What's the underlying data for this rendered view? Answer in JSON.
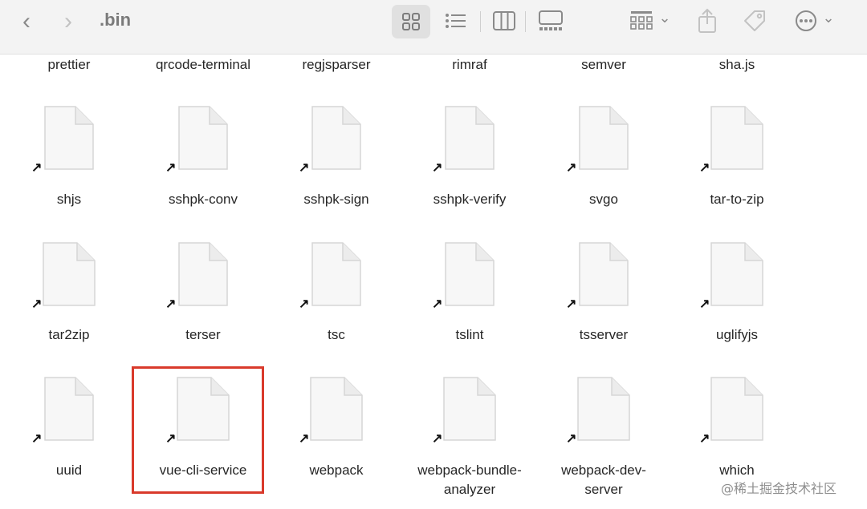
{
  "window": {
    "title": ".bin"
  },
  "toolbar": {
    "back": "‹",
    "forward": "›",
    "group_chevron": "⌄",
    "more_chevron": "⌄"
  },
  "files": {
    "row0": [
      "prettier",
      "qrcode-terminal",
      "regjsparser",
      "rimraf",
      "semver",
      "sha.js"
    ],
    "row1": [
      "shjs",
      "sshpk-conv",
      "sshpk-sign",
      "sshpk-verify",
      "svgo",
      "tar-to-zip"
    ],
    "row2": [
      "tar2zip",
      "terser",
      "tsc",
      "tslint",
      "tsserver",
      "uglifyjs"
    ],
    "row3": [
      [
        "uuid"
      ],
      [
        "vue-cli-service"
      ],
      [
        "webpack"
      ],
      [
        "webpack-bundle-",
        "analyzer"
      ],
      [
        "webpack-dev-",
        "server"
      ],
      [
        "which"
      ]
    ]
  },
  "alias_glyph": "↗",
  "watermark": "@稀土掘金技术社区"
}
